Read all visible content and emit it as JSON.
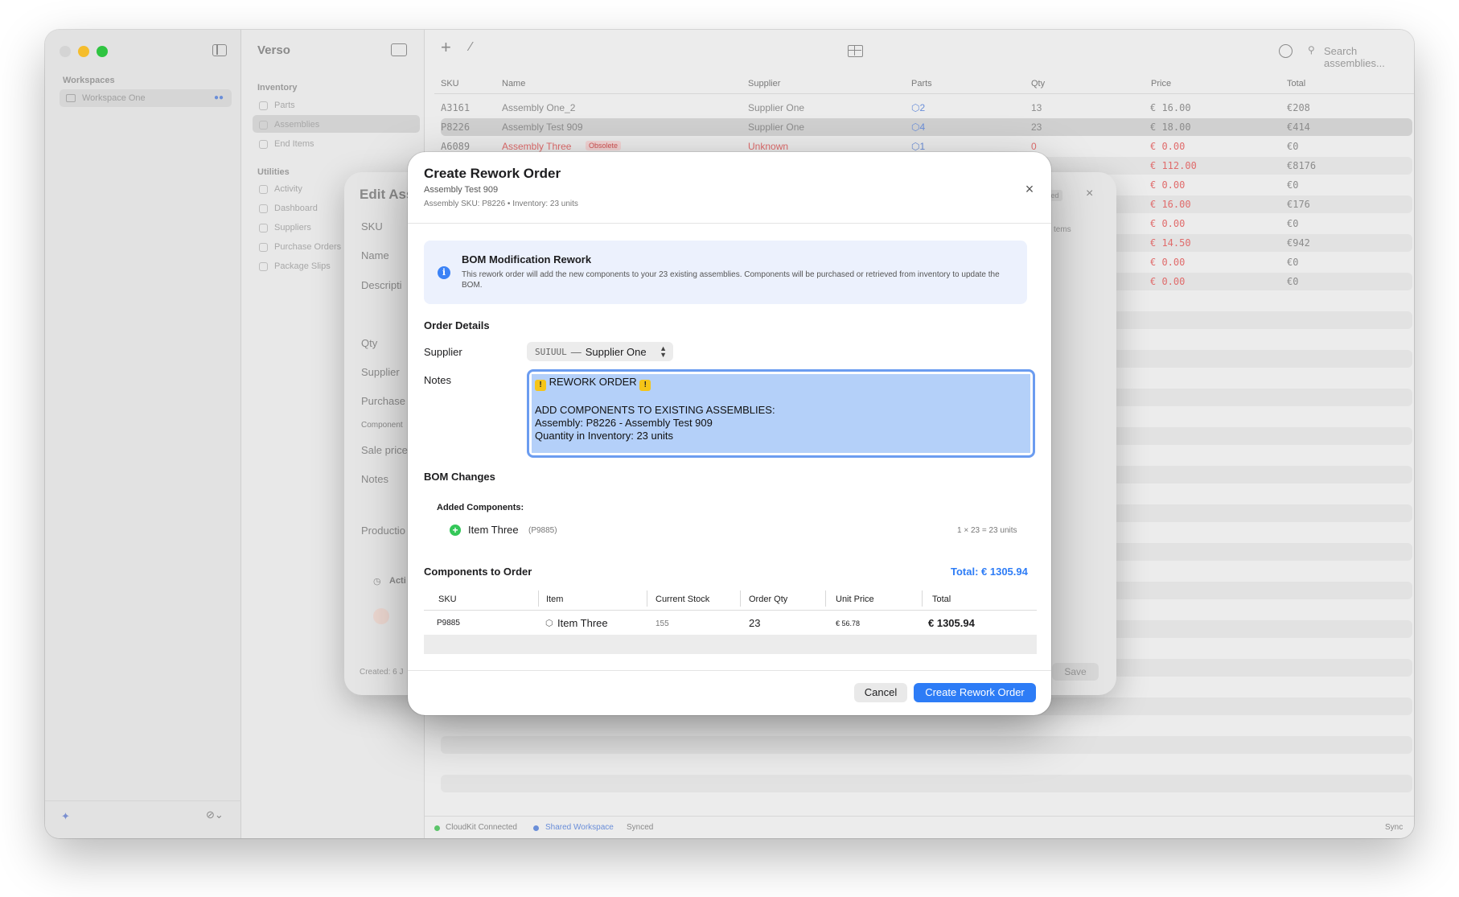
{
  "app": {
    "workspaces_header": "Workspaces",
    "workspace_name": "Workspace One",
    "title": "Verso",
    "search_placeholder": "Search assemblies..."
  },
  "sidebar": {
    "inventory_header": "Inventory",
    "inventory_items": [
      "Parts",
      "Assemblies",
      "End Items"
    ],
    "utilities_header": "Utilities",
    "utilities_items": [
      "Activity",
      "Dashboard",
      "Suppliers",
      "Purchase Orders",
      "Package Slips"
    ]
  },
  "table": {
    "columns": [
      "SKU",
      "Name",
      "Supplier",
      "Parts",
      "Qty",
      "Price",
      "Total"
    ],
    "rows": [
      {
        "sku": "A3161",
        "name": "Assembly One_2",
        "supplier": "Supplier One",
        "parts": "2",
        "qty": "13",
        "price": "€ 16.00",
        "total": "€208"
      },
      {
        "sku": "P8226",
        "name": "Assembly Test 909",
        "supplier": "Supplier One",
        "parts": "4",
        "qty": "23",
        "price": "€ 18.00",
        "total": "€414"
      },
      {
        "sku": "A6089",
        "name": "Assembly Three",
        "badge": "Obsolete",
        "supplier": "Unknown",
        "parts": "1",
        "qty": "0",
        "price": "€ 0.00",
        "total": "€0"
      },
      {
        "price": "€ 112.00",
        "total": "€8176"
      },
      {
        "price": "€ 0.00",
        "total": "€0"
      },
      {
        "price": "€ 16.00",
        "total": "€176"
      },
      {
        "price": "€ 0.00",
        "total": "€0"
      },
      {
        "price": "€ 14.50",
        "total": "€942"
      },
      {
        "price": "€ 0.00",
        "total": "€0"
      },
      {
        "price": "€ 0.00",
        "total": "€0"
      }
    ]
  },
  "statusbar": {
    "cloud": "CloudKit Connected",
    "shared": "Shared Workspace",
    "synced": "Synced",
    "sync_right": "Sync"
  },
  "edit_sheet": {
    "title": "Edit Ass",
    "labels": [
      "SKU",
      "Name",
      "Descripti",
      "Qty",
      "Supplier",
      "Purchase",
      "Component",
      "Sale price",
      "Notes",
      "Productio"
    ],
    "activity": "Acti",
    "created": "Created: 6 J",
    "badge_partial": "sed",
    "items_partial": "tems",
    "save": "Save"
  },
  "modal": {
    "title": "Create Rework Order",
    "subtitle": "Assembly Test 909",
    "meta": "Assembly SKU: P8226 • Inventory: 23 units",
    "info_title": "BOM Modification Rework",
    "info_text": "This rework order will add the new components to your 23 existing assemblies. Components will be purchased or retrieved from inventory to update the BOM.",
    "order_details": "Order Details",
    "supplier_label": "Supplier",
    "supplier_code": "SUIUUL",
    "supplier_name": "Supplier One",
    "notes_label": "Notes",
    "notes_line1": "REWORK ORDER",
    "notes_body": "ADD COMPONENTS TO EXISTING ASSEMBLIES:\nAssembly: P8226 - Assembly Test 909\nQuantity in Inventory: 23 units",
    "bom_changes": "BOM Changes",
    "added_components": "Added Components:",
    "added_item": "Item Three",
    "added_sku": "(P9885)",
    "added_calc": "1 × 23 = 23 units",
    "components_to_order": "Components to Order",
    "total": "Total: € 1305.94",
    "columns": [
      "SKU",
      "Item",
      "Current Stock",
      "Order Qty",
      "Unit Price",
      "Total"
    ],
    "row": {
      "sku": "P9885",
      "item": "Item Three",
      "stock": "155",
      "qty": "23",
      "unit": "€ 56.78",
      "total": "€ 1305.94"
    },
    "cancel": "Cancel",
    "create": "Create Rework Order"
  }
}
